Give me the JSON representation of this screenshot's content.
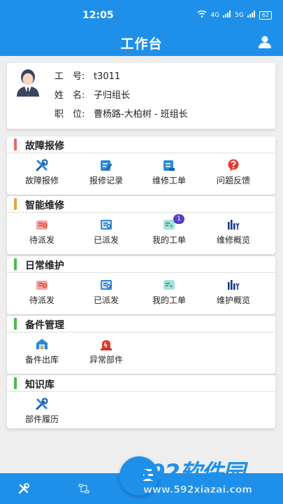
{
  "status_bar": {
    "time": "12:05",
    "signal1": "4G",
    "signal2": "5G",
    "battery": "62"
  },
  "header": {
    "title": "工作台"
  },
  "profile": {
    "rows": [
      {
        "key": "工　号:",
        "value": "t3011"
      },
      {
        "key": "姓　名:",
        "value": "子归组长"
      },
      {
        "key": "职　位:",
        "value": "曹杨路-大柏树 - 班组长"
      }
    ]
  },
  "sections": [
    {
      "title": "故障报修",
      "bar_color": "#e96a6a",
      "items": [
        {
          "label": "故障报修",
          "icon": "wrench-cross-icon"
        },
        {
          "label": "报修记录",
          "icon": "record-edit-icon"
        },
        {
          "label": "维修工单",
          "icon": "order-edit-icon"
        },
        {
          "label": "问题反馈",
          "icon": "question-icon"
        }
      ]
    },
    {
      "title": "智能维修",
      "bar_color": "#e9a445",
      "items": [
        {
          "label": "待派发",
          "icon": "pending-dispatch-icon"
        },
        {
          "label": "已派发",
          "icon": "dispatched-icon"
        },
        {
          "label": "我的工单",
          "icon": "my-order-icon",
          "badge": "1"
        },
        {
          "label": "维修概览",
          "icon": "bar-chart-icon"
        }
      ]
    },
    {
      "title": "日常维护",
      "bar_color": "#4cbb4c",
      "items": [
        {
          "label": "待派发",
          "icon": "pending-dispatch-icon"
        },
        {
          "label": "已派发",
          "icon": "dispatched-icon"
        },
        {
          "label": "我的工单",
          "icon": "my-order-icon"
        },
        {
          "label": "维护概览",
          "icon": "bar-chart-icon"
        }
      ]
    },
    {
      "title": "备件管理",
      "bar_color": "#4cbb4c",
      "items": [
        {
          "label": "备件出库",
          "icon": "warehouse-icon"
        },
        {
          "label": "异常部件",
          "icon": "alarm-icon"
        }
      ]
    },
    {
      "title": "知识库",
      "bar_color": "#4cbb4c",
      "items": [
        {
          "label": "部件履历",
          "icon": "wrench-cross-icon"
        }
      ]
    }
  ],
  "bottom_nav": [
    {
      "icon": "tools-icon"
    },
    {
      "icon": "workflow-icon"
    }
  ],
  "watermark": {
    "brand": "592软件园",
    "url": "www.592xiazai.com"
  }
}
